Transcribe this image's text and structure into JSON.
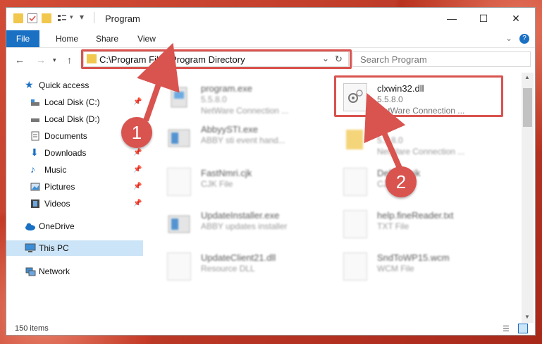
{
  "window": {
    "title": "Program",
    "minimize": "—",
    "maximize": "☐",
    "close": "✕"
  },
  "ribbon": {
    "tabs": [
      "File",
      "Home",
      "Share",
      "View"
    ],
    "help": "?"
  },
  "address": {
    "path": "C:\\Program Files\\Program Directory",
    "search_placeholder": "Search Program"
  },
  "sidebar": {
    "quick_access": "Quick access",
    "items": [
      {
        "label": "Local Disk (C:)",
        "pinned": true
      },
      {
        "label": "Local Disk (D:)",
        "pinned": false
      },
      {
        "label": "Documents",
        "pinned": true
      },
      {
        "label": "Downloads",
        "pinned": true
      },
      {
        "label": "Music",
        "pinned": true
      },
      {
        "label": "Pictures",
        "pinned": true
      },
      {
        "label": "Videos",
        "pinned": true
      }
    ],
    "onedrive": "OneDrive",
    "this_pc": "This PC",
    "network": "Network"
  },
  "files": [
    {
      "name": "program.exe",
      "line2": "5.5.8.0",
      "line3": "NetWare Connection ..."
    },
    {
      "name": "clxwin32.dll",
      "line2": "5.5.8.0",
      "line3": "NetWare Connection ..."
    },
    {
      "name": "AbbyySTI.exe",
      "line2": "ABBY sti event hand...",
      "line3": ""
    },
    {
      "name": "...",
      "line2": "5.5.8.0",
      "line3": "NetWare Connection ..."
    },
    {
      "name": "FastNmri.cjk",
      "line2": "CJK File",
      "line3": ""
    },
    {
      "name": "Def...nt.cjk",
      "line2": "CJK File",
      "line3": ""
    },
    {
      "name": "UpdateInstaller.exe",
      "line2": "ABBY updates installer",
      "line3": ""
    },
    {
      "name": "help.fineReader.txt",
      "line2": "TXT File",
      "line3": ""
    },
    {
      "name": "UpdateClient21.dll",
      "line2": "Resource DLL",
      "line3": ""
    },
    {
      "name": "SndToWP15.wcm",
      "line2": "WCM File",
      "line3": ""
    }
  ],
  "status": {
    "count": "150 items"
  },
  "annotations": {
    "step1": "1",
    "step2": "2",
    "color": "#d9534f"
  }
}
